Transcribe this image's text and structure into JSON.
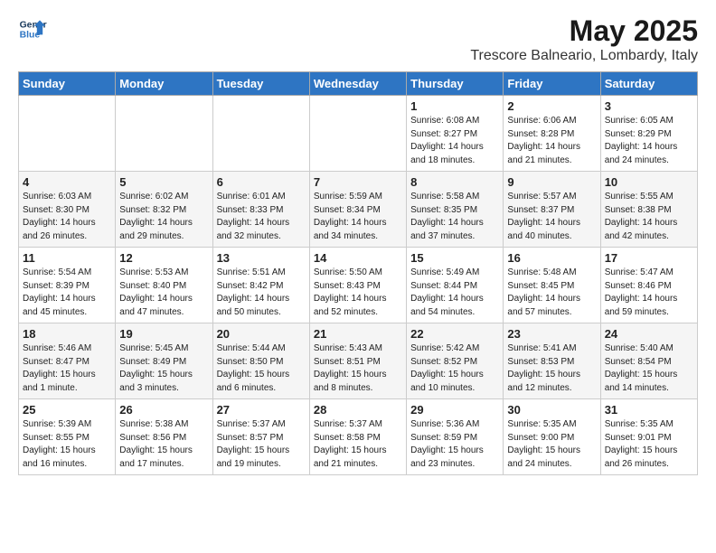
{
  "header": {
    "logo_line1": "General",
    "logo_line2": "Blue",
    "main_title": "May 2025",
    "subtitle": "Trescore Balneario, Lombardy, Italy"
  },
  "days_of_week": [
    "Sunday",
    "Monday",
    "Tuesday",
    "Wednesday",
    "Thursday",
    "Friday",
    "Saturday"
  ],
  "weeks": [
    [
      {
        "day": "",
        "info": ""
      },
      {
        "day": "",
        "info": ""
      },
      {
        "day": "",
        "info": ""
      },
      {
        "day": "",
        "info": ""
      },
      {
        "day": "1",
        "info": "Sunrise: 6:08 AM\nSunset: 8:27 PM\nDaylight: 14 hours\nand 18 minutes."
      },
      {
        "day": "2",
        "info": "Sunrise: 6:06 AM\nSunset: 8:28 PM\nDaylight: 14 hours\nand 21 minutes."
      },
      {
        "day": "3",
        "info": "Sunrise: 6:05 AM\nSunset: 8:29 PM\nDaylight: 14 hours\nand 24 minutes."
      }
    ],
    [
      {
        "day": "4",
        "info": "Sunrise: 6:03 AM\nSunset: 8:30 PM\nDaylight: 14 hours\nand 26 minutes."
      },
      {
        "day": "5",
        "info": "Sunrise: 6:02 AM\nSunset: 8:32 PM\nDaylight: 14 hours\nand 29 minutes."
      },
      {
        "day": "6",
        "info": "Sunrise: 6:01 AM\nSunset: 8:33 PM\nDaylight: 14 hours\nand 32 minutes."
      },
      {
        "day": "7",
        "info": "Sunrise: 5:59 AM\nSunset: 8:34 PM\nDaylight: 14 hours\nand 34 minutes."
      },
      {
        "day": "8",
        "info": "Sunrise: 5:58 AM\nSunset: 8:35 PM\nDaylight: 14 hours\nand 37 minutes."
      },
      {
        "day": "9",
        "info": "Sunrise: 5:57 AM\nSunset: 8:37 PM\nDaylight: 14 hours\nand 40 minutes."
      },
      {
        "day": "10",
        "info": "Sunrise: 5:55 AM\nSunset: 8:38 PM\nDaylight: 14 hours\nand 42 minutes."
      }
    ],
    [
      {
        "day": "11",
        "info": "Sunrise: 5:54 AM\nSunset: 8:39 PM\nDaylight: 14 hours\nand 45 minutes."
      },
      {
        "day": "12",
        "info": "Sunrise: 5:53 AM\nSunset: 8:40 PM\nDaylight: 14 hours\nand 47 minutes."
      },
      {
        "day": "13",
        "info": "Sunrise: 5:51 AM\nSunset: 8:42 PM\nDaylight: 14 hours\nand 50 minutes."
      },
      {
        "day": "14",
        "info": "Sunrise: 5:50 AM\nSunset: 8:43 PM\nDaylight: 14 hours\nand 52 minutes."
      },
      {
        "day": "15",
        "info": "Sunrise: 5:49 AM\nSunset: 8:44 PM\nDaylight: 14 hours\nand 54 minutes."
      },
      {
        "day": "16",
        "info": "Sunrise: 5:48 AM\nSunset: 8:45 PM\nDaylight: 14 hours\nand 57 minutes."
      },
      {
        "day": "17",
        "info": "Sunrise: 5:47 AM\nSunset: 8:46 PM\nDaylight: 14 hours\nand 59 minutes."
      }
    ],
    [
      {
        "day": "18",
        "info": "Sunrise: 5:46 AM\nSunset: 8:47 PM\nDaylight: 15 hours\nand 1 minute."
      },
      {
        "day": "19",
        "info": "Sunrise: 5:45 AM\nSunset: 8:49 PM\nDaylight: 15 hours\nand 3 minutes."
      },
      {
        "day": "20",
        "info": "Sunrise: 5:44 AM\nSunset: 8:50 PM\nDaylight: 15 hours\nand 6 minutes."
      },
      {
        "day": "21",
        "info": "Sunrise: 5:43 AM\nSunset: 8:51 PM\nDaylight: 15 hours\nand 8 minutes."
      },
      {
        "day": "22",
        "info": "Sunrise: 5:42 AM\nSunset: 8:52 PM\nDaylight: 15 hours\nand 10 minutes."
      },
      {
        "day": "23",
        "info": "Sunrise: 5:41 AM\nSunset: 8:53 PM\nDaylight: 15 hours\nand 12 minutes."
      },
      {
        "day": "24",
        "info": "Sunrise: 5:40 AM\nSunset: 8:54 PM\nDaylight: 15 hours\nand 14 minutes."
      }
    ],
    [
      {
        "day": "25",
        "info": "Sunrise: 5:39 AM\nSunset: 8:55 PM\nDaylight: 15 hours\nand 16 minutes."
      },
      {
        "day": "26",
        "info": "Sunrise: 5:38 AM\nSunset: 8:56 PM\nDaylight: 15 hours\nand 17 minutes."
      },
      {
        "day": "27",
        "info": "Sunrise: 5:37 AM\nSunset: 8:57 PM\nDaylight: 15 hours\nand 19 minutes."
      },
      {
        "day": "28",
        "info": "Sunrise: 5:37 AM\nSunset: 8:58 PM\nDaylight: 15 hours\nand 21 minutes."
      },
      {
        "day": "29",
        "info": "Sunrise: 5:36 AM\nSunset: 8:59 PM\nDaylight: 15 hours\nand 23 minutes."
      },
      {
        "day": "30",
        "info": "Sunrise: 5:35 AM\nSunset: 9:00 PM\nDaylight: 15 hours\nand 24 minutes."
      },
      {
        "day": "31",
        "info": "Sunrise: 5:35 AM\nSunset: 9:01 PM\nDaylight: 15 hours\nand 26 minutes."
      }
    ]
  ]
}
